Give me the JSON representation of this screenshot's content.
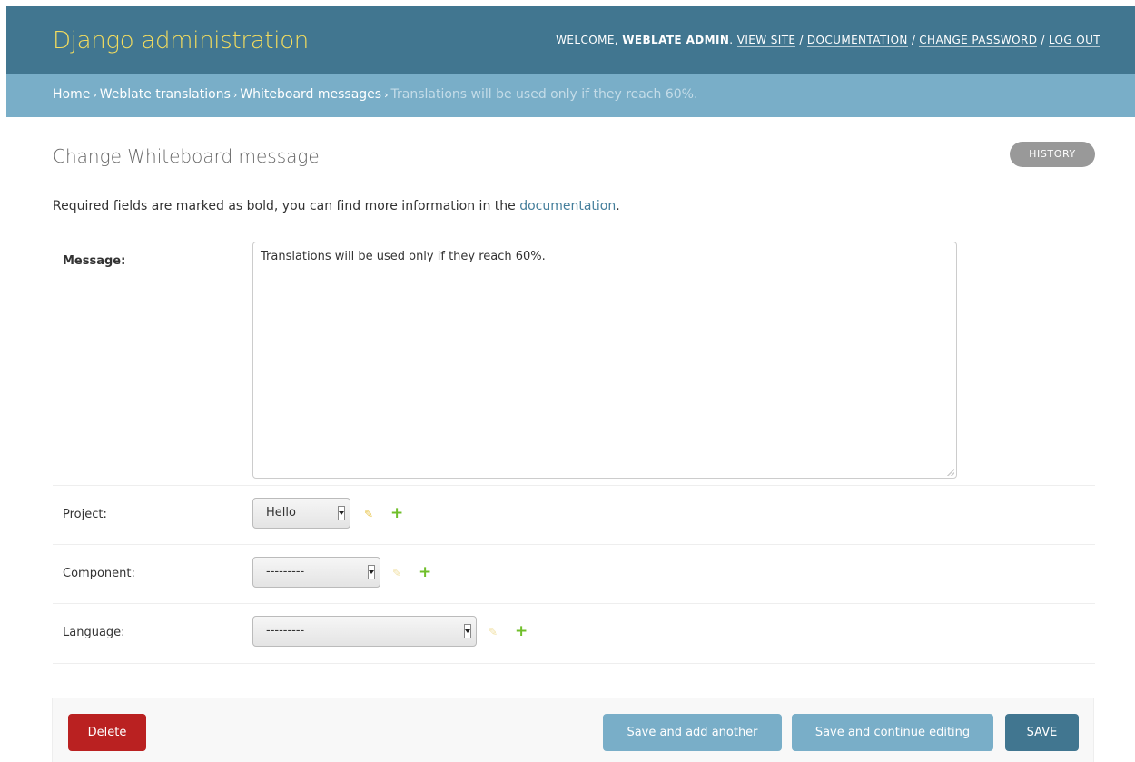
{
  "header": {
    "site_name": "Django administration",
    "welcome_prefix": "WELCOME,",
    "user_name": "WEBLATE ADMIN",
    "links": [
      "VIEW SITE",
      "DOCUMENTATION",
      "CHANGE PASSWORD",
      "LOG OUT"
    ]
  },
  "breadcrumbs": {
    "items": [
      "Home",
      "Weblate translations",
      "Whiteboard messages"
    ],
    "current": "Translations will be used only if they reach 60%.",
    "separator": "›"
  },
  "page": {
    "title": "Change Whiteboard message",
    "history_label": "HISTORY",
    "help_prefix": "Required fields are marked as bold, you can find more information in the ",
    "help_link": "documentation",
    "help_suffix": "."
  },
  "form": {
    "message": {
      "label": "Message:",
      "value": "Translations will be used only if they reach 60%."
    },
    "project": {
      "label": "Project:",
      "selected": "Hello"
    },
    "component": {
      "label": "Component:",
      "selected": "---------"
    },
    "language": {
      "label": "Language:",
      "selected": "---------"
    }
  },
  "actions": {
    "delete": "Delete",
    "save_add_another": "Save and add another",
    "save_continue": "Save and continue editing",
    "save": "SAVE"
  },
  "colors": {
    "header_bg": "#417690",
    "breadcrumbs_bg": "#79aec8",
    "site_name": "#f5dd5d",
    "delete_bg": "#ba2121",
    "save_bg": "#417690",
    "add_icon": "#70bf2b",
    "edit_icon": "#e8c44a"
  },
  "icons": {
    "edit": "pencil-icon",
    "add": "plus-icon"
  }
}
